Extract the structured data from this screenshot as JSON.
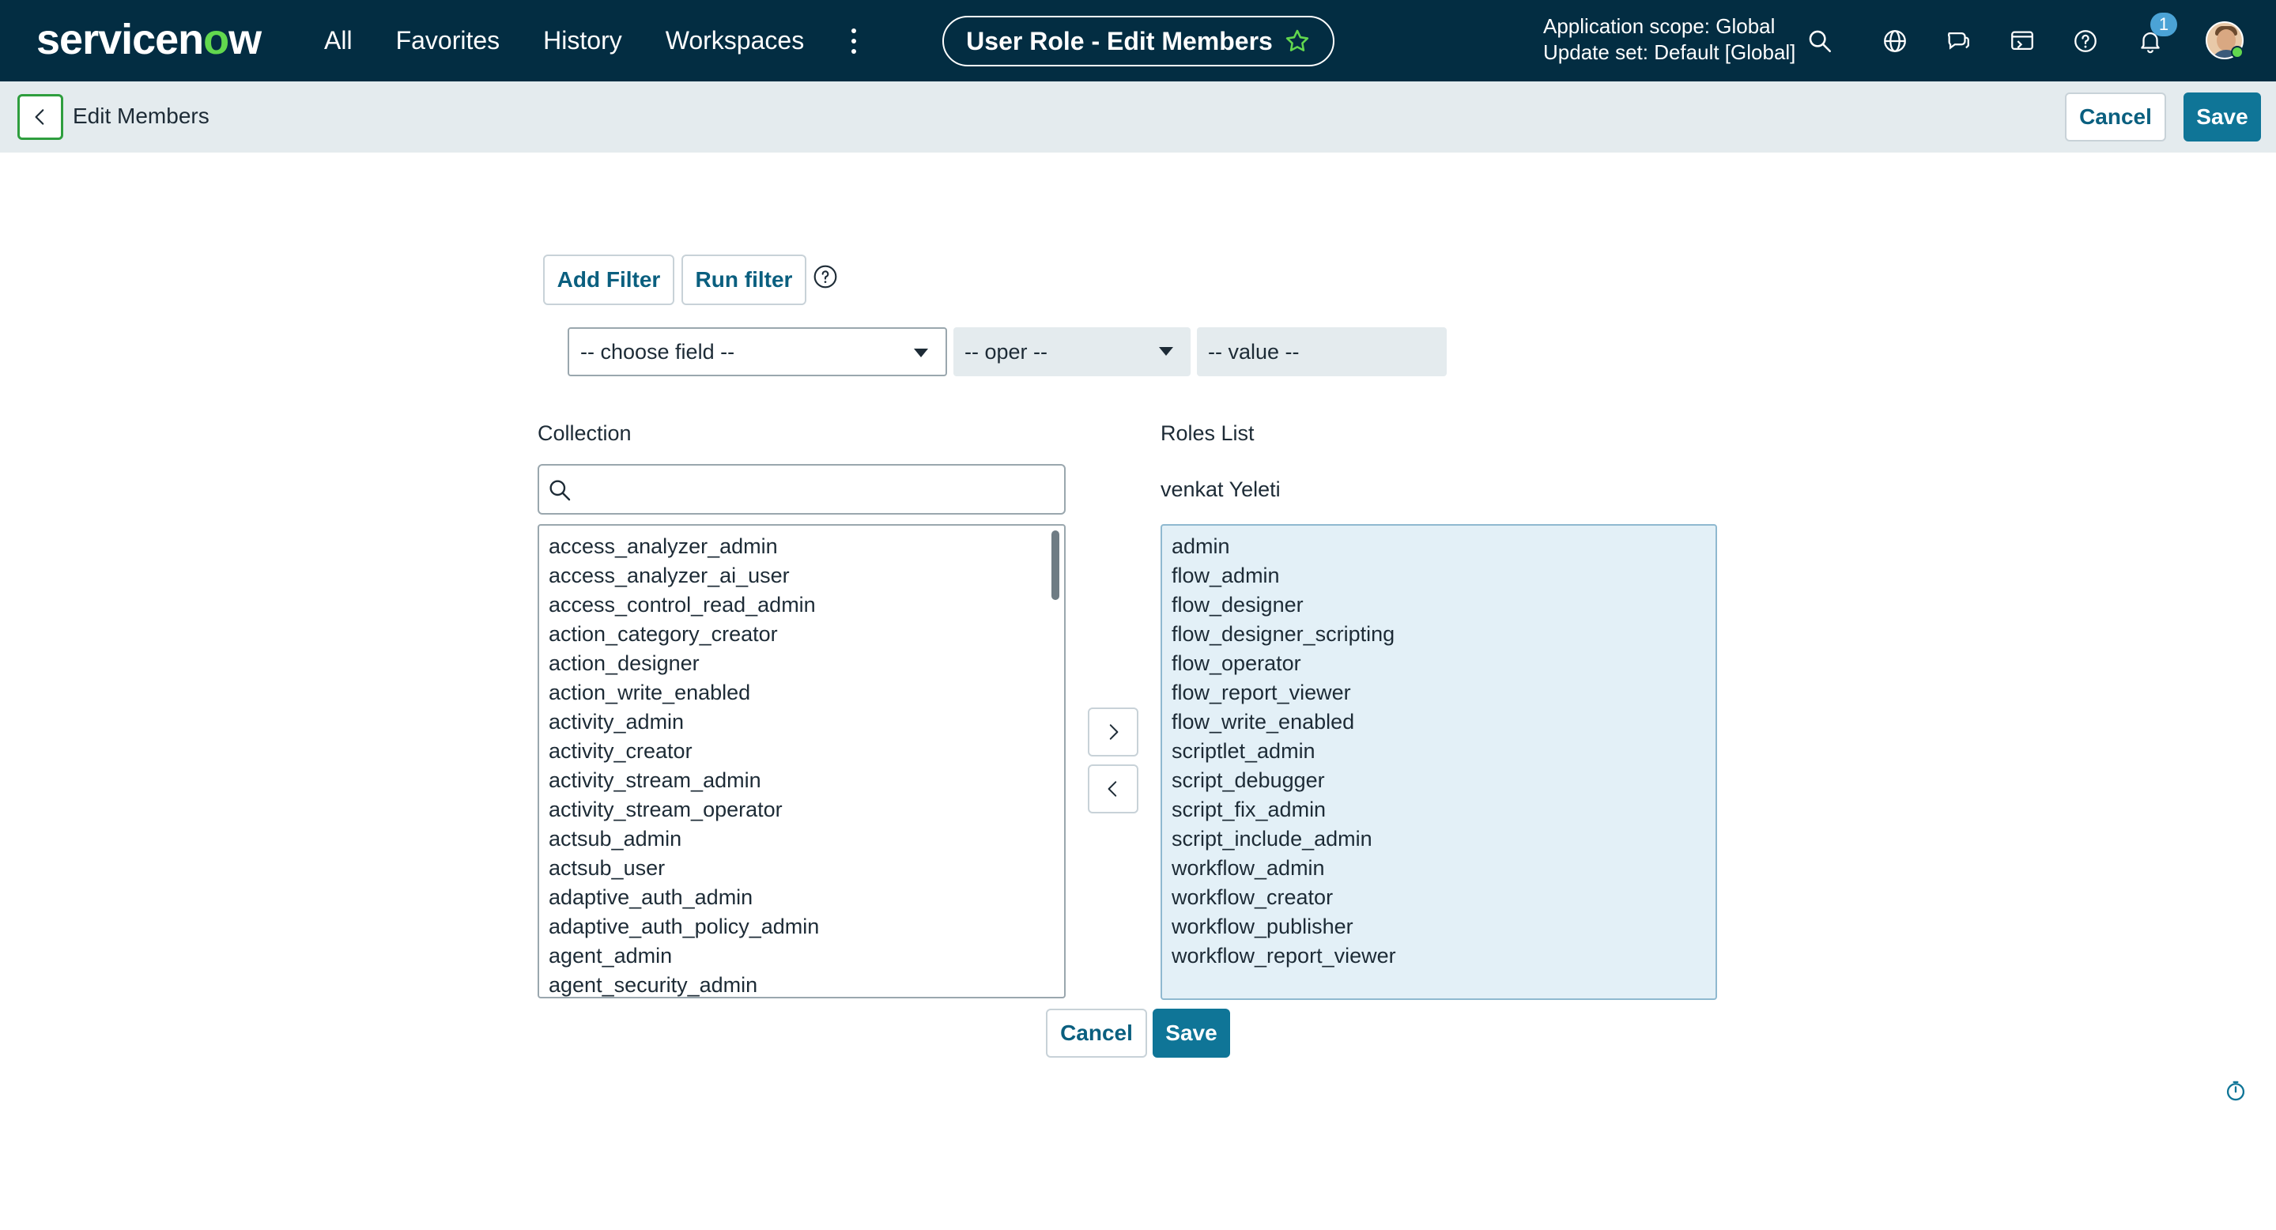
{
  "nav": {
    "logo_prefix": "servicen",
    "logo_o": "o",
    "logo_suffix": "w",
    "links": [
      "All",
      "Favorites",
      "History",
      "Workspaces"
    ],
    "record_title": "User Role - Edit Members",
    "scope_line1": "Application scope: Global",
    "scope_line2": "Update set: Default [Global]",
    "notification_count": "1",
    "icons": [
      "search-icon",
      "globe-icon",
      "chat-icon",
      "contextual-app-icon",
      "help-icon",
      "bell-icon"
    ]
  },
  "subheader": {
    "title": "Edit Members",
    "cancel_label": "Cancel",
    "save_label": "Save"
  },
  "filter": {
    "add_filter_label": "Add Filter",
    "run_filter_label": "Run filter",
    "field_select": "-- choose field --",
    "oper_select": "-- oper --",
    "value_field": "-- value --"
  },
  "collection": {
    "label": "Collection",
    "search_placeholder": "",
    "items": [
      "access_analyzer_admin",
      "access_analyzer_ai_user",
      "access_control_read_admin",
      "action_category_creator",
      "action_designer",
      "action_write_enabled",
      "activity_admin",
      "activity_creator",
      "activity_stream_admin",
      "activity_stream_operator",
      "actsub_admin",
      "actsub_user",
      "adaptive_auth_admin",
      "adaptive_auth_policy_admin",
      "agent_admin",
      "agent_security_admin"
    ]
  },
  "roles_list": {
    "label": "Roles List",
    "user_name": "venkat Yeleti",
    "items": [
      "admin",
      "flow_admin",
      "flow_designer",
      "flow_designer_scripting",
      "flow_operator",
      "flow_report_viewer",
      "flow_write_enabled",
      "scriptlet_admin",
      "script_debugger",
      "script_fix_admin",
      "script_include_admin",
      "workflow_admin",
      "workflow_creator",
      "workflow_publisher",
      "workflow_report_viewer"
    ]
  },
  "footer": {
    "cancel_label": "Cancel",
    "save_label": "Save"
  },
  "colors": {
    "nav_bg": "#032d42",
    "accent_green": "#62d84e",
    "primary_button": "#0f7597",
    "roles_bg": "#e3f0f7"
  }
}
